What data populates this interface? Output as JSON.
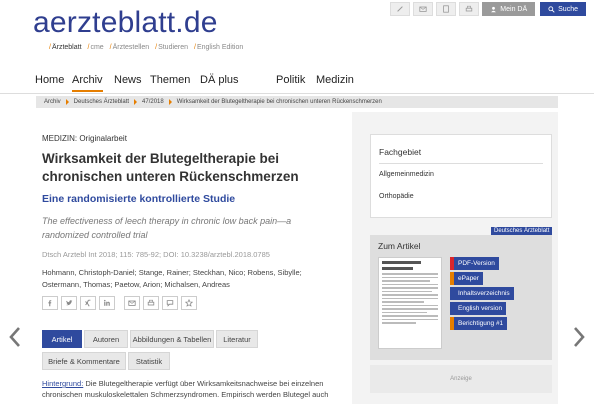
{
  "header": {
    "logo": "aerzteblatt.de",
    "subnav": [
      "Ärzteblatt",
      "cme",
      "Ärztestellen",
      "Studieren",
      "English Edition"
    ],
    "tools": [
      "pencil-icon",
      "mail-icon",
      "document-icon",
      "print-icon"
    ],
    "account_label": "Mein DÄ",
    "search_label": "Suche"
  },
  "mainnav": {
    "items": [
      "Home",
      "Archiv",
      "News",
      "Themen",
      "DÄ plus",
      "Politik",
      "Medizin"
    ]
  },
  "breadcrumb": [
    "Archiv",
    "Deutsches Ärzteblatt",
    "47/2018",
    "Wirksamkeit der Blutegeltherapie bei chronischen unteren Rückenschmerzen"
  ],
  "article": {
    "kicker": "MEDIZIN: Originalarbeit",
    "title_line1": "Wirksamkeit der Blutegeltherapie bei",
    "title_line2": "chronischen unteren Rückenschmerzen",
    "subtitle": "Eine randomisierte kontrollierte Studie",
    "en_title_line1": "The effectiveness of leech therapy in chronic low back pain—a",
    "en_title_line2": "randomized controlled trial",
    "citation": "Dtsch Arztebl Int 2018; 115: 785-92; DOI: 10.3238/arztebl.2018.0785",
    "authors_line1": "Hohmann, Christoph-Daniel; Stange, Rainer; Steckhan, Nico; Robens, Sibylle;",
    "authors_line2": "Ostermann, Thomas; Paetow, Arion; Michalsen, Andreas",
    "tabs": [
      "Artikel",
      "Autoren",
      "Abbildungen & Tabellen",
      "Literatur",
      "Briefe & Kommentare",
      "Statistik"
    ],
    "intro_label": "Hintergrund:",
    "intro_line1": " Die Blutegeltherapie verfügt über Wirksamkeitsnachweise bei einzelnen",
    "intro_line2": "chronischen muskuloskelettalen Schmerzsyndromen. Empirisch werden Blutegel auch"
  },
  "sidebar": {
    "fachgebiet_heading": "Fachgebiet",
    "fachgebiet_items": [
      "Allgemeinmedizin",
      "Orthopädie"
    ],
    "badge": "Deutsches Ärzteblatt",
    "zum_artikel_heading": "Zum Artikel",
    "article_links": [
      {
        "label": "PDF-Version",
        "color": "#d9262b"
      },
      {
        "label": "ePaper",
        "color": "#e67e00"
      },
      {
        "label": "Inhaltsverzeichnis",
        "color": "#2f4a9e"
      },
      {
        "label": "English version",
        "color": "#2f4a9e"
      },
      {
        "label": "Berichtigung #1",
        "color": "#e67e00"
      }
    ],
    "ad_label": "Anzeige"
  },
  "colors": {
    "brand_blue": "#2f4a9e",
    "accent_orange": "#e67e00"
  }
}
